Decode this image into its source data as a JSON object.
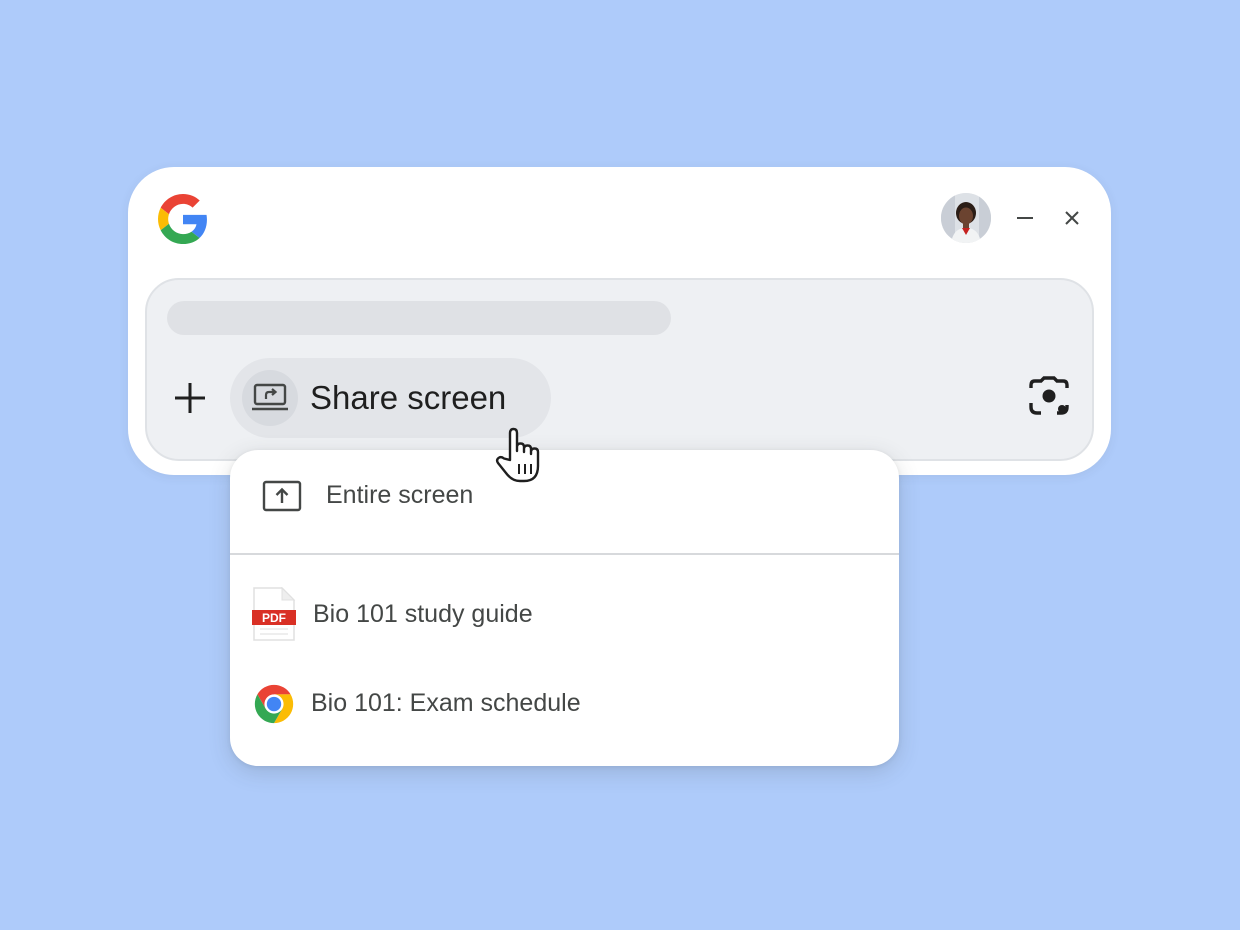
{
  "app": {
    "logo_icon": "google-g-icon",
    "account_avatar_icon": "account-avatar",
    "window_controls": {
      "minimize_icon": "minimize-icon",
      "close_icon": "close-icon"
    }
  },
  "composer": {
    "add_icon": "plus-icon",
    "share_chip": {
      "icon": "share-screen-icon",
      "label": "Share screen"
    },
    "lens_icon": "google-lens-icon"
  },
  "share_menu": {
    "entire_screen": {
      "icon": "present-screen-icon",
      "label": "Entire screen"
    },
    "items": [
      {
        "icon": "pdf-file-icon",
        "label": "Bio 101 study guide",
        "badge": "PDF"
      },
      {
        "icon": "chrome-icon",
        "label": "Bio 101: Exam schedule"
      }
    ]
  },
  "colors": {
    "background": "#aecbfa",
    "window": "#ffffff",
    "input_surface": "#eef0f3",
    "chip": "#e3e5e9",
    "pdf_red": "#d93025",
    "google_blue": "#4285f4",
    "google_red": "#ea4335",
    "google_yellow": "#fbbc05",
    "google_green": "#34a853"
  }
}
